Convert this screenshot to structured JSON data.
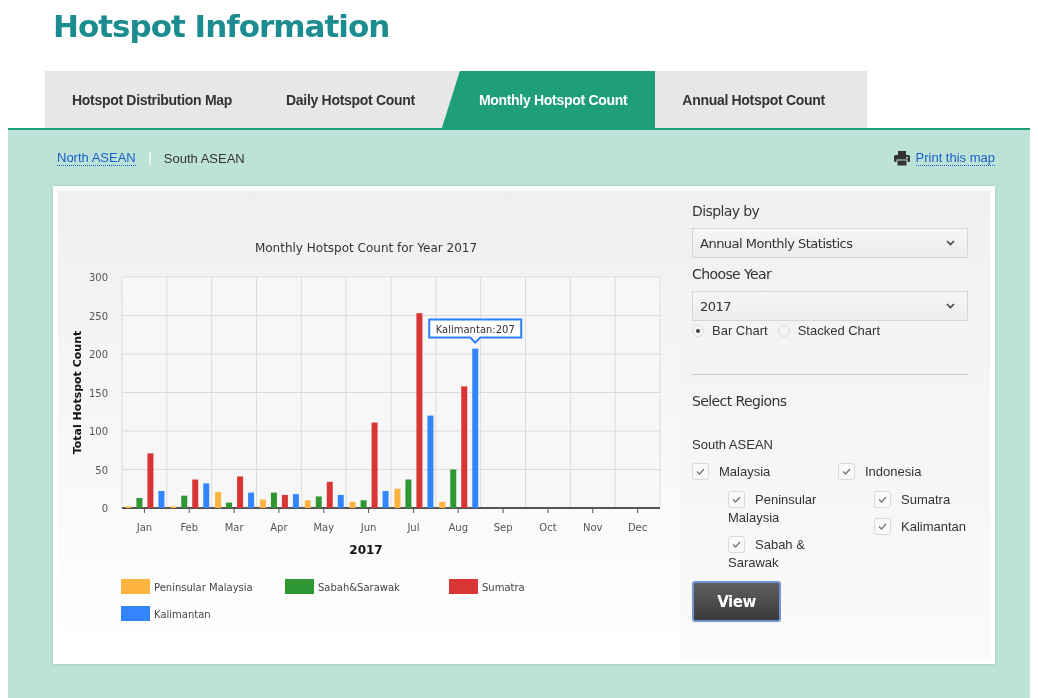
{
  "page_title": "Hotspot Information",
  "tabs": [
    {
      "label": "Hotspot Distribution Map",
      "selected": false
    },
    {
      "label": "Daily Hotspot Count",
      "selected": false
    },
    {
      "label": "Monthly Hotspot Count",
      "selected": true
    },
    {
      "label": "Annual Hotspot Count",
      "selected": false
    }
  ],
  "sub_nav": {
    "links": [
      {
        "label": "North ASEAN",
        "selected": false
      },
      {
        "label": "South ASEAN",
        "selected": true
      }
    ],
    "print_link": "Print this map"
  },
  "chart": {
    "tooltip": "Kalimantan:207",
    "chart_data": {
      "type": "bar",
      "title": "Monthly Hotspot Count for Year 2017",
      "xlabel": "2017",
      "ylabel": "Total Hotspot Count",
      "categories": [
        "Jan",
        "Feb",
        "Mar",
        "Apr",
        "May",
        "Jun",
        "Jul",
        "Aug",
        "Sep",
        "Oct",
        "Nov",
        "Dec"
      ],
      "series": [
        {
          "name": "Peninsular Malaysia",
          "color": "#ffb340",
          "values": [
            2,
            2,
            21,
            11,
            10,
            8,
            25,
            8,
            null,
            null,
            null,
            null
          ]
        },
        {
          "name": "Sabah&Sarawak",
          "color": "#2e9632",
          "values": [
            13,
            16,
            7,
            20,
            15,
            10,
            37,
            50,
            null,
            null,
            null,
            null
          ]
        },
        {
          "name": "Sumatra",
          "color": "#d93535",
          "values": [
            71,
            37,
            41,
            17,
            34,
            111,
            253,
            158,
            null,
            null,
            null,
            null
          ]
        },
        {
          "name": "Kalimantan",
          "color": "#3385ff",
          "values": [
            22,
            32,
            20,
            18,
            17,
            22,
            120,
            207,
            null,
            null,
            null,
            null
          ]
        }
      ],
      "ylim": [
        0,
        300
      ],
      "yticks": [
        0,
        50,
        100,
        150,
        200,
        250,
        300
      ],
      "stacked": false,
      "orientation": "vertical",
      "grid": true,
      "legend": true
    }
  },
  "controls": {
    "display_by": {
      "label": "Display by",
      "value": "Annual Monthly Statistics"
    },
    "year": {
      "label": "Choose Year",
      "value": "2017"
    },
    "chart_types": [
      {
        "label": "Bar Chart",
        "selected": true
      },
      {
        "label": "Stacked Chart",
        "selected": false
      }
    ],
    "regions_title": "Select Regions",
    "group_label": "South ASEAN",
    "regions": [
      {
        "label": "Malaysia",
        "checked": true,
        "children": [
          {
            "label": "Peninsular Malaysia",
            "checked": true
          },
          {
            "label": "Sabah & Sarawak",
            "checked": true
          }
        ]
      },
      {
        "label": "Indonesia",
        "checked": true,
        "children": [
          {
            "label": "Sumatra",
            "checked": true
          },
          {
            "label": "Kalimantan",
            "checked": true
          }
        ]
      }
    ],
    "view_button": "View"
  }
}
